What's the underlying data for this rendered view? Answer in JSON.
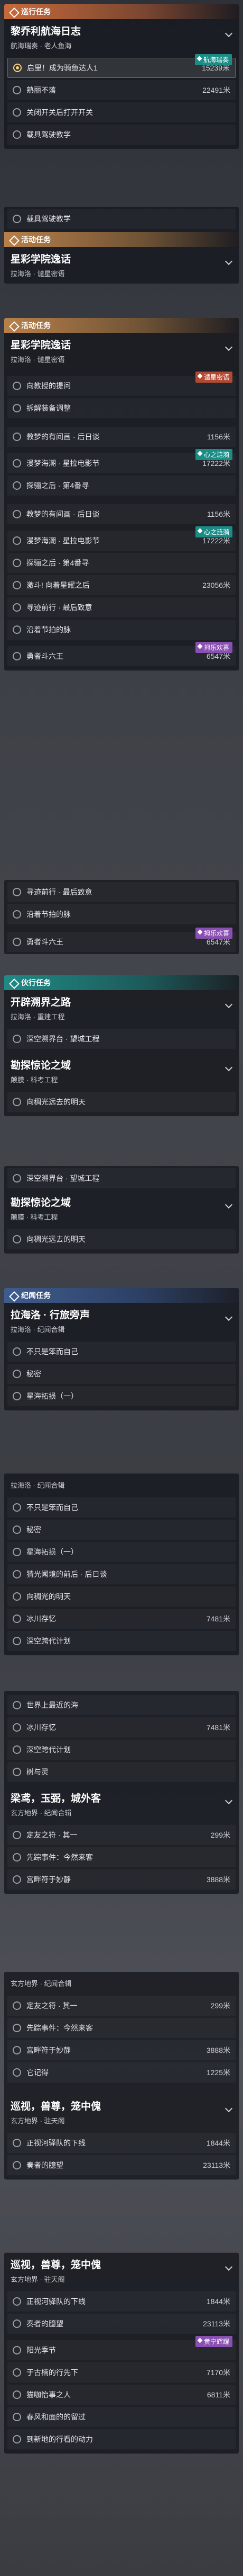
{
  "cats": {
    "trail": "巡行任务",
    "event": "活动任务",
    "companion": "伙行任务",
    "world": "纪闻任务"
  },
  "q1": {
    "title": "黎乔利航海日志",
    "sub": "航海瑞奏 · 老人鱼海",
    "tasks": [
      {
        "name": "启里！成为骑鱼达人1",
        "dist": "15239米",
        "flag": "航海瑞奏"
      },
      {
        "name": "熟丽不落",
        "dist": "22491米"
      },
      {
        "name": "关闭开关后打开开关",
        "dist": ""
      },
      {
        "name": "载具驾驶教学",
        "dist": ""
      }
    ]
  },
  "q2": {
    "tasks": [
      {
        "name": "载具驾驶教学",
        "dist": ""
      }
    ],
    "title": "星彩学院逸话",
    "sub": "拉海洛 · 谴星密语"
  },
  "q3": {
    "title": "星彩学院逸话",
    "sub": "拉海洛 · 谴星密语",
    "flag": "谴星密语",
    "tasks": [
      {
        "name": "向教授的提问",
        "dist": ""
      },
      {
        "name": "拆解装备调整",
        "dist": ""
      },
      {
        "name": "教梦的有间画 · 后日谈",
        "dist": "1156米"
      },
      {
        "name": "漫梦海潮 · 星拉电影节",
        "dist": "17222米",
        "flag": "心之涟漪"
      },
      {
        "name": "探骊之后 · 第4番寻",
        "dist": ""
      },
      {
        "name": "教梦的有间画 · 后日谈",
        "dist": "1156米"
      },
      {
        "name": "漫梦海潮 · 星拉电影节",
        "dist": "17222米",
        "flag": "心之涟漪"
      },
      {
        "name": "探骊之后 · 第4番寻",
        "dist": ""
      },
      {
        "name": "激斗! 向着星耀之后",
        "dist": "23056米"
      },
      {
        "name": "寻迹前行 · 最后致意",
        "dist": ""
      },
      {
        "name": "沿着节拍的脉",
        "dist": ""
      },
      {
        "name": "勇者斗六王",
        "dist": "6547米",
        "flag": "拇乐欢喜"
      }
    ]
  },
  "q4": {
    "tasks": [
      {
        "name": "寻迹前行 · 最后致意",
        "dist": ""
      },
      {
        "name": "沿着节拍的脉",
        "dist": ""
      },
      {
        "name": "勇者斗六王",
        "dist": "6547米",
        "flag": "拇乐欢喜"
      }
    ]
  },
  "q5": {
    "title": "开辟溯界之路",
    "sub": "拉海洛 · 重建工程",
    "tasks": [
      {
        "name": "深空溯界台 · 望城工程",
        "dist": ""
      },
      {
        "name": "深空浮升 · 载塔工程",
        "dist": ""
      }
    ]
  },
  "q6": {
    "title": "勘探惊论之域",
    "sub": "颠膜 · 科考工程",
    "tasks": [
      {
        "name": "向稠光远去的明天",
        "dist": ""
      }
    ]
  },
  "q7": {
    "tasks": [
      {
        "name": "深空溯界台 · 望城工程",
        "dist": ""
      }
    ],
    "title": "勘探惊论之域",
    "sub": "颠膜 · 科考工程",
    "tasks2": [
      {
        "name": "向稠光远去的明天",
        "dist": ""
      }
    ]
  },
  "q8": {
    "title": "拉海洛 · 行旅旁声",
    "sub": "拉海洛 · 纪闻合辑",
    "tasks": [
      {
        "name": "不只是笨而自己",
        "dist": ""
      },
      {
        "name": "秘密",
        "dist": ""
      },
      {
        "name": "星海拓损（一）",
        "dist": ""
      }
    ]
  },
  "q9": {
    "sub": "拉海洛 · 纪闻合辑",
    "tasks": [
      {
        "name": "不只是笨而自己",
        "dist": ""
      },
      {
        "name": "秘密",
        "dist": ""
      },
      {
        "name": "星海拓损（一）",
        "dist": ""
      },
      {
        "name": "猜光闻境的前后 · 后日谈",
        "dist": ""
      },
      {
        "name": "向稠光的明天",
        "dist": ""
      },
      {
        "name": "冰川存忆",
        "dist": "7481米"
      },
      {
        "name": "深空跨代计划",
        "dist": ""
      }
    ]
  },
  "q10": {
    "tasks": [
      {
        "name": "世界上最近的海",
        "dist": ""
      },
      {
        "name": "冰川存忆",
        "dist": "7481米"
      },
      {
        "name": "深空跨代计划",
        "dist": ""
      },
      {
        "name": "树与灵",
        "dist": ""
      }
    ]
  },
  "q11": {
    "title": "梁鸢，玉弼，城外客",
    "sub": "玄方地界 · 纪闻合辑",
    "tasks": [
      {
        "name": "定友之符 · 其一",
        "dist": "299米"
      },
      {
        "name": "先踪事件：今然来客",
        "dist": ""
      },
      {
        "name": "宫畔符于妙静",
        "dist": "3888米"
      }
    ]
  },
  "q12": {
    "sub": "玄方地界 · 纪闻合辑",
    "tasks": [
      {
        "name": "定友之符 · 其一",
        "dist": "299米"
      },
      {
        "name": "先踪事件：今然来客",
        "dist": ""
      },
      {
        "name": "宫畔符于妙静",
        "dist": "3888米"
      },
      {
        "name": "它记得",
        "dist": "1225米"
      }
    ]
  },
  "q13": {
    "title": "巡视，兽尊，笼中傀",
    "sub": "玄方地界 · 驻天阁",
    "tasks": [
      {
        "name": "正视河驿队的下线",
        "dist": "1844米"
      },
      {
        "name": "奏者的臆望",
        "dist": "23113米"
      }
    ]
  },
  "q14": {
    "title": "巡视，兽尊，笼中傀",
    "sub": "玄方地界 · 驻天阁",
    "tasks": [
      {
        "name": "正视河驿队的下线",
        "dist": "1844米"
      },
      {
        "name": "奏者的臆望",
        "dist": "23113米"
      },
      {
        "name": "阳光季节",
        "dist": "",
        "flag": "黄宁辉耀"
      },
      {
        "name": "于古楠的行先下",
        "dist": "7170米"
      },
      {
        "name": "猫咖怡事之人",
        "dist": "6811米"
      },
      {
        "name": "春风和面的的留过",
        "dist": ""
      },
      {
        "name": "到新地的行看的动力",
        "dist": ""
      }
    ]
  }
}
